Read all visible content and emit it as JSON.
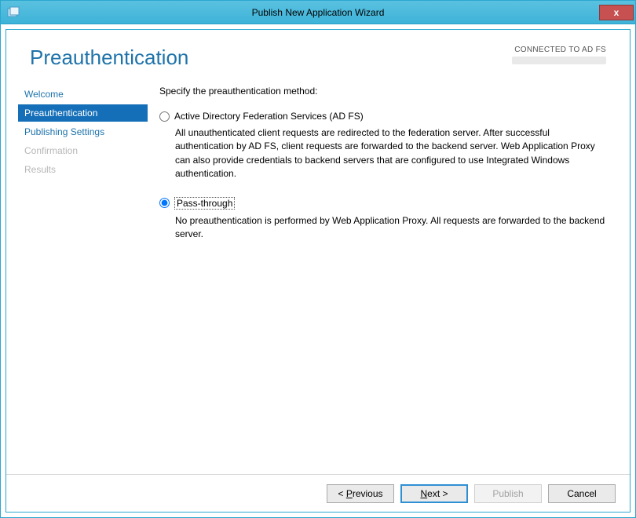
{
  "window": {
    "title": "Publish New Application Wizard"
  },
  "header": {
    "page_title": "Preauthentication",
    "connection_status": "CONNECTED TO AD FS"
  },
  "sidebar": {
    "items": [
      {
        "label": "Welcome",
        "state": "normal"
      },
      {
        "label": "Preauthentication",
        "state": "active"
      },
      {
        "label": "Publishing Settings",
        "state": "normal"
      },
      {
        "label": "Confirmation",
        "state": "disabled"
      },
      {
        "label": "Results",
        "state": "disabled"
      }
    ]
  },
  "main": {
    "instruction": "Specify the preauthentication method:",
    "options": [
      {
        "id": "adfs",
        "label": "Active Directory Federation Services (AD FS)",
        "selected": false,
        "description": "All unauthenticated client requests are redirected to the federation server. After successful authentication by AD FS, client requests are forwarded to the backend server. Web Application Proxy can also provide credentials to backend servers that are configured to use Integrated Windows authentication."
      },
      {
        "id": "passthrough",
        "label": "Pass-through",
        "selected": true,
        "description": "No preauthentication is performed by Web Application Proxy. All requests are forwarded to the backend server."
      }
    ]
  },
  "buttons": {
    "previous": "< Previous",
    "next": "Next >",
    "publish": "Publish",
    "cancel": "Cancel"
  }
}
